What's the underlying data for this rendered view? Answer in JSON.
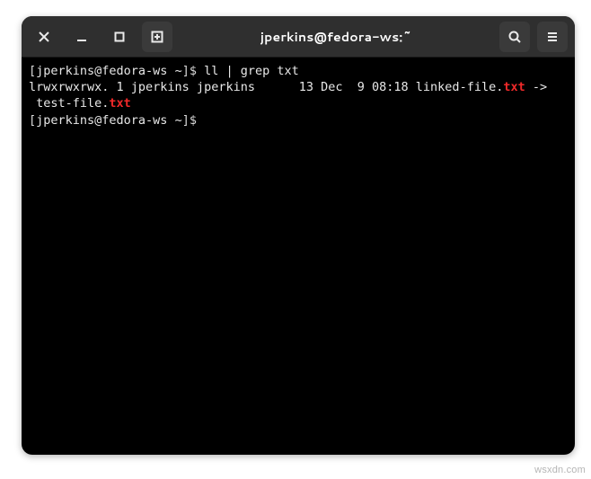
{
  "window": {
    "title": "jperkins@fedora-ws:~"
  },
  "toolbar": {
    "close_icon": "close-icon",
    "minimize_icon": "minimize-icon",
    "maximize_icon": "maximize-icon",
    "newtab_icon": "new-tab-icon",
    "search_icon": "search-icon",
    "menu_icon": "hamburger-menu-icon"
  },
  "terminal": {
    "lines": [
      {
        "prompt_open": "[",
        "prompt_user": "jperkins@fedora-ws ~",
        "prompt_close": "]$ ",
        "command": "ll | grep txt"
      },
      {
        "perms": "lrwxrwxrwx. 1 jperkins jperkins",
        "spacer": "      ",
        "size_date": "13 Dec  9 08:18 ",
        "filename_pre": "linked-file.",
        "filename_hl": "txt",
        "arrow": " ->"
      },
      {
        "target_pre": " test-file.",
        "target_hl": "txt"
      },
      {
        "prompt_open": "[",
        "prompt_user": "jperkins@fedora-ws ~",
        "prompt_close": "]$ ",
        "command": ""
      }
    ]
  },
  "watermark": "wsxdn.com"
}
